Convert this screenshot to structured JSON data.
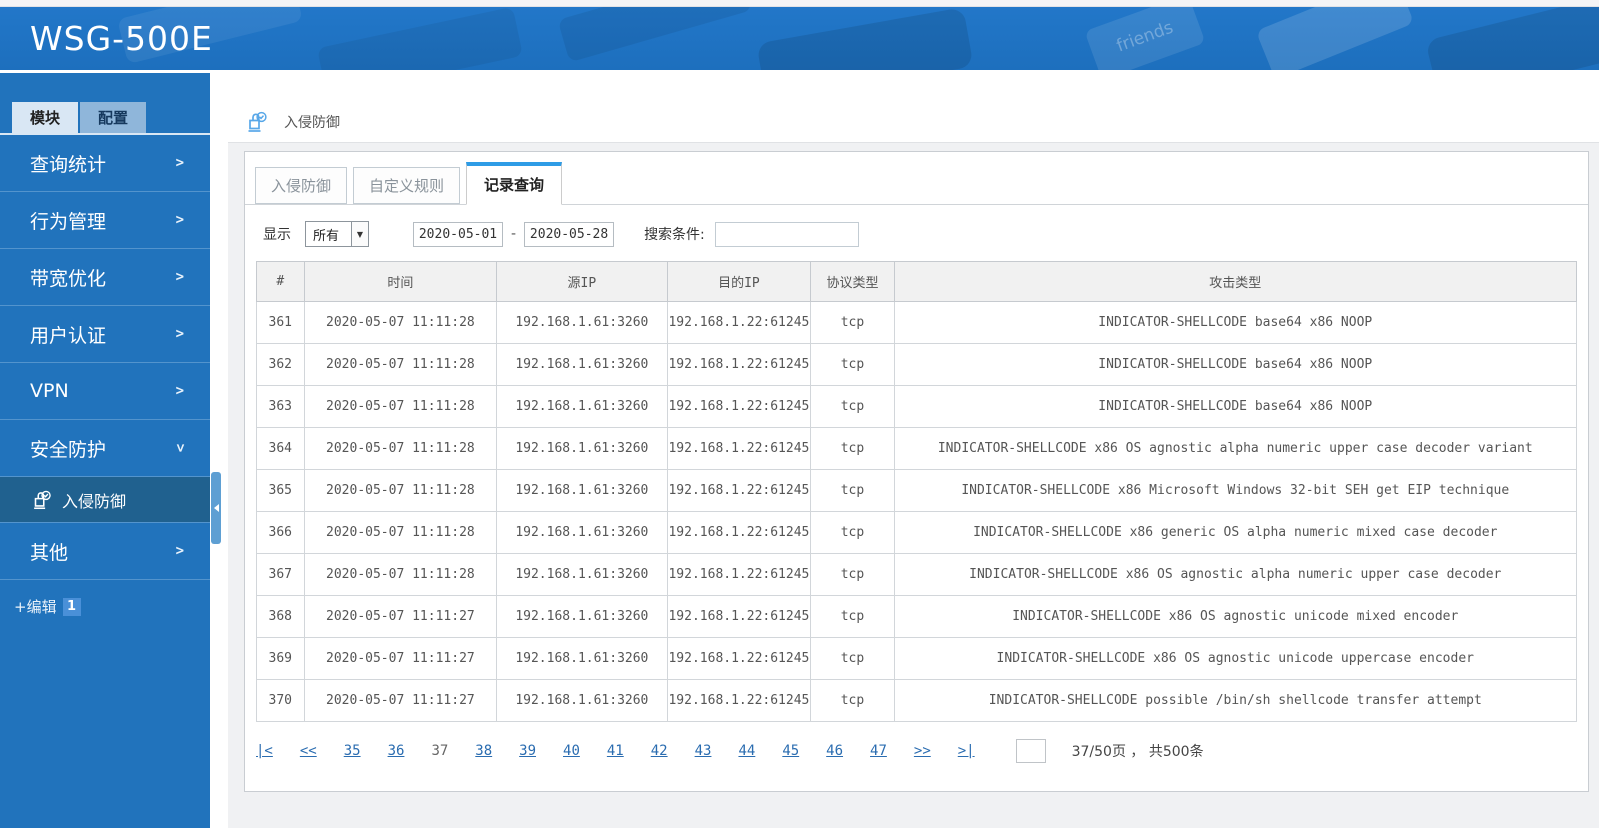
{
  "colors": {
    "brand_blue": "#1e72c0",
    "sidebar_blue": "#2173bc",
    "selected_item_blue": "#20618f",
    "active_tab_accent": "#2e9ce6",
    "link_blue": "#2a6cb0"
  },
  "header": {
    "title": "WSG-500E",
    "keycap_text": "friends"
  },
  "sidebar": {
    "tabs": [
      {
        "label": "模块",
        "active": true
      },
      {
        "label": "配置",
        "active": false
      }
    ],
    "items": [
      {
        "label": "查询统计"
      },
      {
        "label": "行为管理"
      },
      {
        "label": "带宽优化"
      },
      {
        "label": "用户认证"
      },
      {
        "label": "VPN"
      },
      {
        "label": "安全防护",
        "expanded": true
      },
      {
        "label": "入侵防御",
        "submenu": true,
        "selected": true,
        "icon": "stamp-icon"
      },
      {
        "label": "其他"
      }
    ],
    "edit_label": "+编辑",
    "edit_badge": "1"
  },
  "breadcrumb": {
    "icon": "stamp-icon",
    "label": "入侵防御"
  },
  "content_tabs": [
    {
      "label": "入侵防御",
      "active": false
    },
    {
      "label": "自定义规则",
      "active": false
    },
    {
      "label": "记录查询",
      "active": true
    }
  ],
  "filters": {
    "display_label": "显示",
    "display_value": "所有",
    "date_from": "2020-05-01",
    "date_separator": "-",
    "date_to": "2020-05-28",
    "search_label": "搜索条件:",
    "search_value": ""
  },
  "table": {
    "columns": [
      "#",
      "时间",
      "源IP",
      "目的IP",
      "协议类型",
      "攻击类型"
    ],
    "rows": [
      [
        "361",
        "2020-05-07 11:11:28",
        "192.168.1.61:3260",
        "192.168.1.22:61245",
        "tcp",
        "INDICATOR-SHELLCODE base64 x86 NOOP"
      ],
      [
        "362",
        "2020-05-07 11:11:28",
        "192.168.1.61:3260",
        "192.168.1.22:61245",
        "tcp",
        "INDICATOR-SHELLCODE base64 x86 NOOP"
      ],
      [
        "363",
        "2020-05-07 11:11:28",
        "192.168.1.61:3260",
        "192.168.1.22:61245",
        "tcp",
        "INDICATOR-SHELLCODE base64 x86 NOOP"
      ],
      [
        "364",
        "2020-05-07 11:11:28",
        "192.168.1.61:3260",
        "192.168.1.22:61245",
        "tcp",
        "INDICATOR-SHELLCODE x86 OS agnostic alpha numeric upper case decoder variant"
      ],
      [
        "365",
        "2020-05-07 11:11:28",
        "192.168.1.61:3260",
        "192.168.1.22:61245",
        "tcp",
        "INDICATOR-SHELLCODE x86 Microsoft Windows 32-bit SEH get EIP technique"
      ],
      [
        "366",
        "2020-05-07 11:11:28",
        "192.168.1.61:3260",
        "192.168.1.22:61245",
        "tcp",
        "INDICATOR-SHELLCODE x86 generic OS alpha numeric mixed case decoder"
      ],
      [
        "367",
        "2020-05-07 11:11:28",
        "192.168.1.61:3260",
        "192.168.1.22:61245",
        "tcp",
        "INDICATOR-SHELLCODE x86 OS agnostic alpha numeric upper case decoder"
      ],
      [
        "368",
        "2020-05-07 11:11:27",
        "192.168.1.61:3260",
        "192.168.1.22:61245",
        "tcp",
        "INDICATOR-SHELLCODE x86 OS agnostic unicode mixed encoder"
      ],
      [
        "369",
        "2020-05-07 11:11:27",
        "192.168.1.61:3260",
        "192.168.1.22:61245",
        "tcp",
        "INDICATOR-SHELLCODE x86 OS agnostic unicode uppercase encoder"
      ],
      [
        "370",
        "2020-05-07 11:11:27",
        "192.168.1.61:3260",
        "192.168.1.22:61245",
        "tcp",
        "INDICATOR-SHELLCODE possible /bin/sh shellcode transfer attempt"
      ]
    ]
  },
  "pagination": {
    "first": "|<",
    "prev": "<<",
    "pages": [
      {
        "label": "35"
      },
      {
        "label": "36"
      },
      {
        "label": "37",
        "current": true
      },
      {
        "label": "38"
      },
      {
        "label": "39"
      },
      {
        "label": "40"
      },
      {
        "label": "41"
      },
      {
        "label": "42"
      },
      {
        "label": "43"
      },
      {
        "label": "44"
      },
      {
        "label": "45"
      },
      {
        "label": "46"
      },
      {
        "label": "47"
      }
    ],
    "next": ">>",
    "last": ">|",
    "goto_value": "",
    "info": "37/50页 ， 共500条"
  }
}
